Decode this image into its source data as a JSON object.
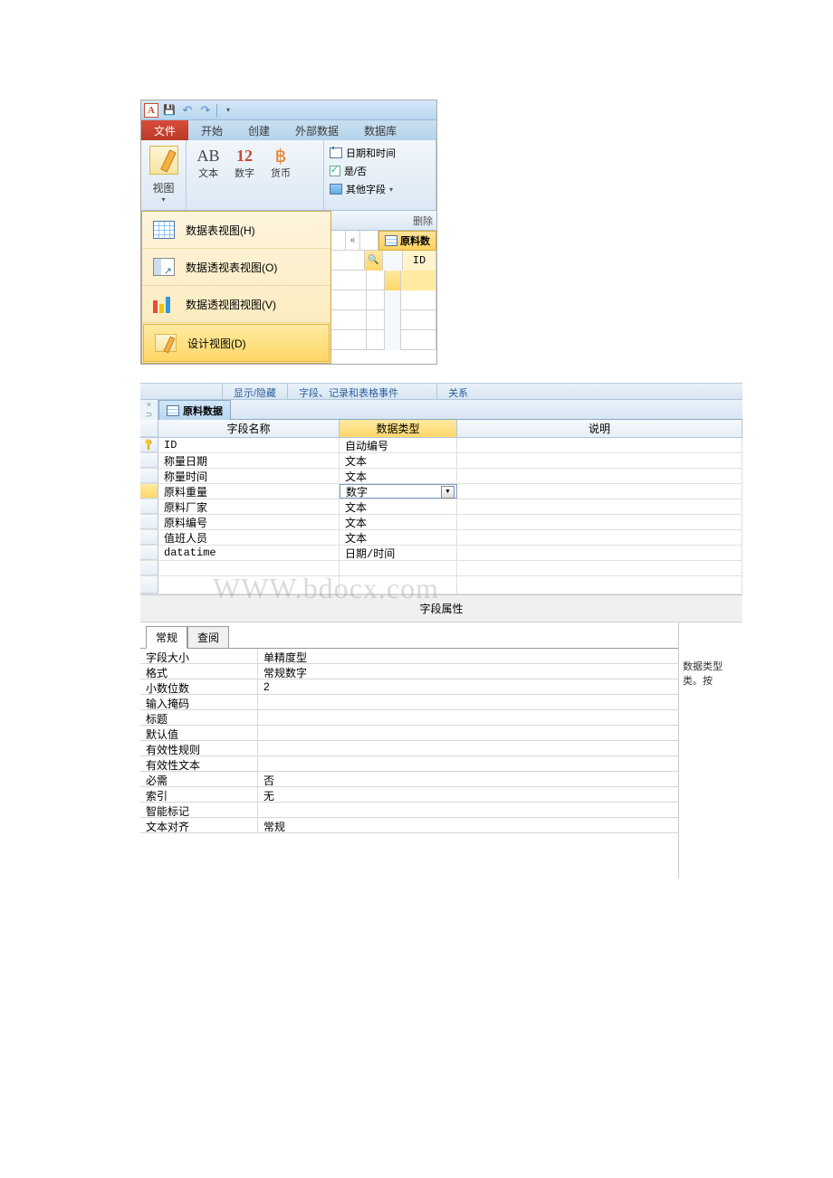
{
  "qat": {
    "undo_tip": "↶",
    "redo_tip": "↷"
  },
  "tabs": {
    "file": "文件",
    "home": "开始",
    "create": "创建",
    "external": "外部数据",
    "database": "数据库"
  },
  "ribbon": {
    "view": "视图",
    "text": "文本",
    "number": "数字",
    "currency": "货币",
    "ab": "AB",
    "twelve": "12",
    "datetime": "日期和时间",
    "yesno": "是/否",
    "morefields": "其他字段",
    "dropdown": "▾",
    "currency_icon": "฿"
  },
  "viewMenu": {
    "datasheet": "数据表视图(H)",
    "pivottable": "数据透视表视图(O)",
    "pivotchart": "数据透视图视图(V)",
    "design": "设计视图(D)"
  },
  "topRight": {
    "delete": "删除",
    "chevron": "«",
    "search_icon": "🔍",
    "tab_title": "原料数",
    "id": "ID"
  },
  "groupLabels": {
    "showhide": "显示/隐藏",
    "fieldsevents": "字段、记录和表格事件",
    "relation": "关系"
  },
  "designView": {
    "leftMarkers": {
      "x": "×",
      "c": "⊃"
    },
    "tabTitle": "原料数据",
    "headers": {
      "fieldname": "字段名称",
      "datatype": "数据类型",
      "description": "说明"
    },
    "rows": [
      {
        "key": true,
        "name": "ID",
        "type": "自动编号",
        "selected": false
      },
      {
        "key": false,
        "name": "称量日期",
        "type": "文本",
        "selected": false
      },
      {
        "key": false,
        "name": "称量时间",
        "type": "文本",
        "selected": false
      },
      {
        "key": false,
        "name": "原料重量",
        "type": "数字",
        "selected": true
      },
      {
        "key": false,
        "name": "原料厂家",
        "type": "文本",
        "selected": false
      },
      {
        "key": false,
        "name": "原料编号",
        "type": "文本",
        "selected": false
      },
      {
        "key": false,
        "name": "值班人员",
        "type": "文本",
        "selected": false
      },
      {
        "key": false,
        "name": "datatime",
        "type": "日期/时间",
        "selected": false
      }
    ],
    "dropdown_arrow": "▼"
  },
  "fieldPropsLabel": "字段属性",
  "propTabs": {
    "general": "常规",
    "lookup": "查阅"
  },
  "properties": [
    {
      "label": "字段大小",
      "value": "单精度型"
    },
    {
      "label": "格式",
      "value": "常规数字"
    },
    {
      "label": "小数位数",
      "value": "2"
    },
    {
      "label": "输入掩码",
      "value": ""
    },
    {
      "label": "标题",
      "value": ""
    },
    {
      "label": "默认值",
      "value": ""
    },
    {
      "label": "有效性规则",
      "value": ""
    },
    {
      "label": "有效性文本",
      "value": ""
    },
    {
      "label": "必需",
      "value": "否"
    },
    {
      "label": "索引",
      "value": "无"
    },
    {
      "label": "智能标记",
      "value": ""
    },
    {
      "label": "文本对齐",
      "value": "常规"
    }
  ],
  "helpText": "数据类型类。按"
}
